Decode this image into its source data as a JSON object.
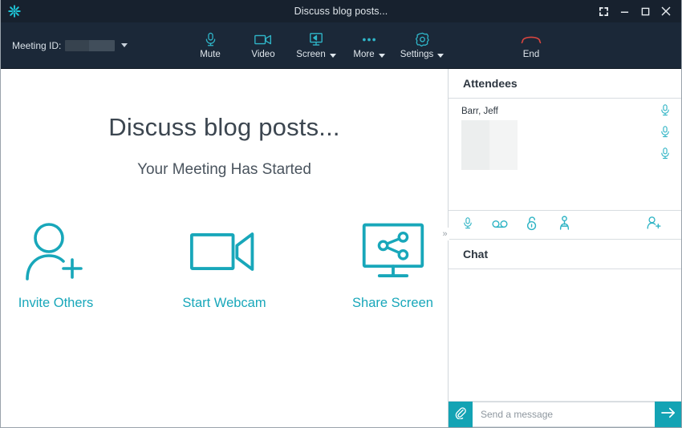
{
  "window": {
    "title": "Discuss blog posts...",
    "logo_icon": "asterisk-logo-icon",
    "controls": [
      {
        "name": "fullscreen",
        "icon": "fullscreen-icon"
      },
      {
        "name": "minimize",
        "icon": "minimize-icon"
      },
      {
        "name": "maximize",
        "icon": "maximize-icon"
      },
      {
        "name": "close",
        "icon": "close-icon"
      }
    ]
  },
  "toolbar": {
    "meeting_id_label": "Meeting ID:",
    "meeting_id_value": "",
    "meeting_id_dropdown_icon": "chevron-down-icon",
    "items": [
      {
        "label": "Mute",
        "icon": "microphone-icon",
        "has_caret": false
      },
      {
        "label": "Video",
        "icon": "video-camera-icon",
        "has_caret": false
      },
      {
        "label": "Screen",
        "icon": "share-screen-icon",
        "has_caret": true
      },
      {
        "label": "More",
        "icon": "ellipsis-icon",
        "has_caret": true
      },
      {
        "label": "Settings",
        "icon": "gear-icon",
        "has_caret": true
      },
      {
        "label": "End",
        "icon": "hang-up-phone-icon",
        "has_caret": false
      }
    ],
    "end_color": "#d9453f"
  },
  "stage": {
    "title": "Discuss blog posts...",
    "subtitle": "Your Meeting Has Started",
    "actions": [
      {
        "label": "Invite Others",
        "icon": "person-add-icon"
      },
      {
        "label": "Start Webcam",
        "icon": "video-camera-icon"
      },
      {
        "label": "Share Screen",
        "icon": "screen-share-icon"
      }
    ]
  },
  "attendees": {
    "header": "Attendees",
    "people": [
      {
        "name": "Barr, Jeff",
        "avatar": "redacted-thumbnail"
      }
    ],
    "mic_icons": [
      "microphone-icon",
      "microphone-icon",
      "microphone-icon"
    ],
    "toolbar_left": [
      {
        "name": "mute-all",
        "icon": "microphone-icon"
      },
      {
        "name": "dial-out",
        "icon": "voicemail-icon"
      },
      {
        "name": "lock-meeting",
        "icon": "unlocked-padlock-icon"
      },
      {
        "name": "presenter",
        "icon": "presenter-person-icon"
      }
    ],
    "toolbar_right": [
      {
        "name": "add-attendee",
        "icon": "person-add-icon"
      }
    ],
    "collapse_icon": "double-chevron-right-icon"
  },
  "chat": {
    "header": "Chat",
    "messages": [],
    "attach_icon": "paperclip-icon",
    "send_icon": "arrow-right-icon",
    "input_value": "",
    "input_placeholder": "Send a message"
  },
  "colors": {
    "titlebar_bg": "#17212e",
    "toolbar_bg": "#1b2838",
    "accent_teal": "#18a7ba",
    "button_teal": "#13a3b4",
    "danger_red": "#d9453f",
    "stage_text": "#3c4650"
  }
}
